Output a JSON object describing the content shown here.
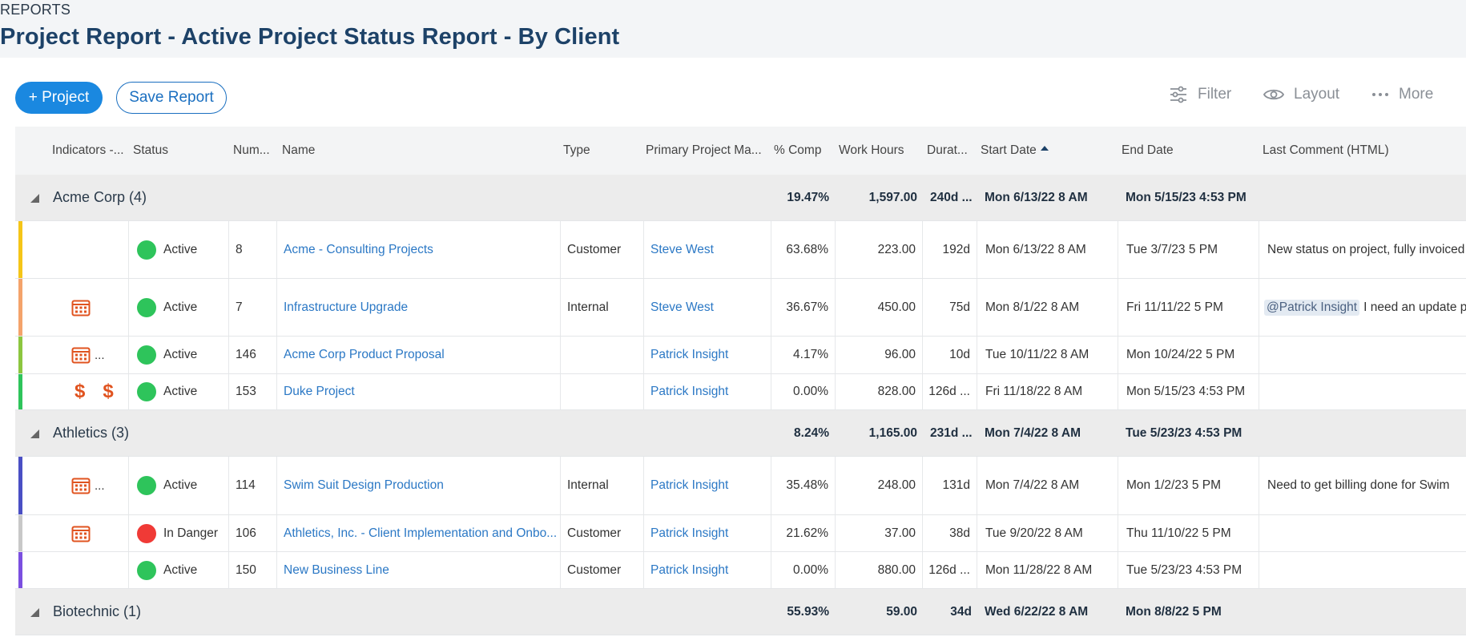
{
  "header": {
    "breadcrumb": "REPORTS",
    "title": "Project Report - Active Project Status Report - By Client"
  },
  "toolbar": {
    "add_project": "+ Project",
    "save_report": "Save Report",
    "filter": "Filter",
    "layout": "Layout",
    "more": "More"
  },
  "columns": {
    "indicators": "Indicators -...",
    "status": "Status",
    "number": "Num...",
    "name": "Name",
    "type": "Type",
    "pm": "Primary Project Ma...",
    "pct": "% Comp",
    "hours": "Work Hours",
    "duration": "Durat...",
    "start": "Start Date",
    "end": "End Date",
    "comment": "Last Comment (HTML)"
  },
  "colors": {
    "primary": "#1a88e0",
    "link": "#2b78c5",
    "title": "#1d4268",
    "active": "#2ec45b",
    "danger": "#f03a36",
    "indicator": "#e0531f"
  },
  "groups": {
    "acme": {
      "name": "Acme Corp (4)",
      "pct": "19.47%",
      "hours": "1,597.00",
      "duration": "240d ...",
      "start": "Mon 6/13/22 8 AM",
      "end": "Mon 5/15/23 4:53 PM"
    },
    "athletics": {
      "name": "Athletics (3)",
      "pct": "8.24%",
      "hours": "1,165.00",
      "duration": "231d ...",
      "start": "Mon 7/4/22 8 AM",
      "end": "Tue 5/23/23 4:53 PM"
    },
    "biotechnic": {
      "name": "Biotechnic (1)",
      "pct": "55.93%",
      "hours": "59.00",
      "duration": "34d",
      "start": "Wed 6/22/22 8 AM",
      "end": "Mon 8/8/22 5 PM"
    }
  },
  "rows": {
    "r1": {
      "status": "Active",
      "number": "8",
      "name": "Acme - Consulting Projects",
      "type": "Customer",
      "pm": "Steve West",
      "pct": "63.68%",
      "hours": "223.00",
      "duration": "192d",
      "start": "Mon 6/13/22 8 AM",
      "end": "Tue 3/7/23 5 PM",
      "comment": "New status on project, fully invoiced",
      "stripe": "#f5c518"
    },
    "r2": {
      "status": "Active",
      "number": "7",
      "name": "Infrastructure Upgrade",
      "type": "Internal",
      "pm": "Steve West",
      "pct": "36.67%",
      "hours": "450.00",
      "duration": "75d",
      "start": "Mon 8/1/22 8 AM",
      "end": "Fri 11/11/22 5 PM",
      "mention": "@Patrick Insight",
      "comment": "I need an update pl",
      "stripe": "#f4a36b"
    },
    "r3": {
      "status": "Active",
      "number": "146",
      "name": "Acme Corp Product Proposal",
      "type": "",
      "pm": "Patrick Insight",
      "pct": "4.17%",
      "hours": "96.00",
      "duration": "10d",
      "start": "Tue 10/11/22 8 AM",
      "end": "Mon 10/24/22 5 PM",
      "comment": "",
      "more": "...",
      "stripe": "#8cc63f"
    },
    "r4": {
      "status": "Active",
      "number": "153",
      "name": "Duke Project",
      "type": "",
      "pm": "Patrick Insight",
      "pct": "0.00%",
      "hours": "828.00",
      "duration": "126d ...",
      "start": "Fri 11/18/22 8 AM",
      "end": "Mon 5/15/23 4:53 PM",
      "comment": "",
      "dollar1": "$",
      "dollar2": "$",
      "stripe": "#2ec45b"
    },
    "r5": {
      "status": "Active",
      "number": "114",
      "name": "Swim Suit Design Production",
      "type": "Internal",
      "pm": "Patrick Insight",
      "pct": "35.48%",
      "hours": "248.00",
      "duration": "131d",
      "start": "Mon 7/4/22 8 AM",
      "end": "Mon 1/2/23 5 PM",
      "comment": "Need to get billing done for Swim",
      "more": "...",
      "stripe": "#4a4fc4"
    },
    "r6": {
      "status": "In Danger",
      "number": "106",
      "name": "Athletics, Inc. - Client Implementation and Onbo...",
      "type": "Customer",
      "pm": "Patrick Insight",
      "pct": "21.62%",
      "hours": "37.00",
      "duration": "38d",
      "start": "Tue 9/20/22 8 AM",
      "end": "Thu 11/10/22 5 PM",
      "comment": "",
      "stripe": "#c8c8c8"
    },
    "r7": {
      "status": "Active",
      "number": "150",
      "name": "New Business Line",
      "type": "Customer",
      "pm": "Patrick Insight",
      "pct": "0.00%",
      "hours": "880.00",
      "duration": "126d ...",
      "start": "Mon 11/28/22 8 AM",
      "end": "Tue 5/23/23 4:53 PM",
      "comment": "",
      "stripe": "#7b4fe0"
    }
  }
}
